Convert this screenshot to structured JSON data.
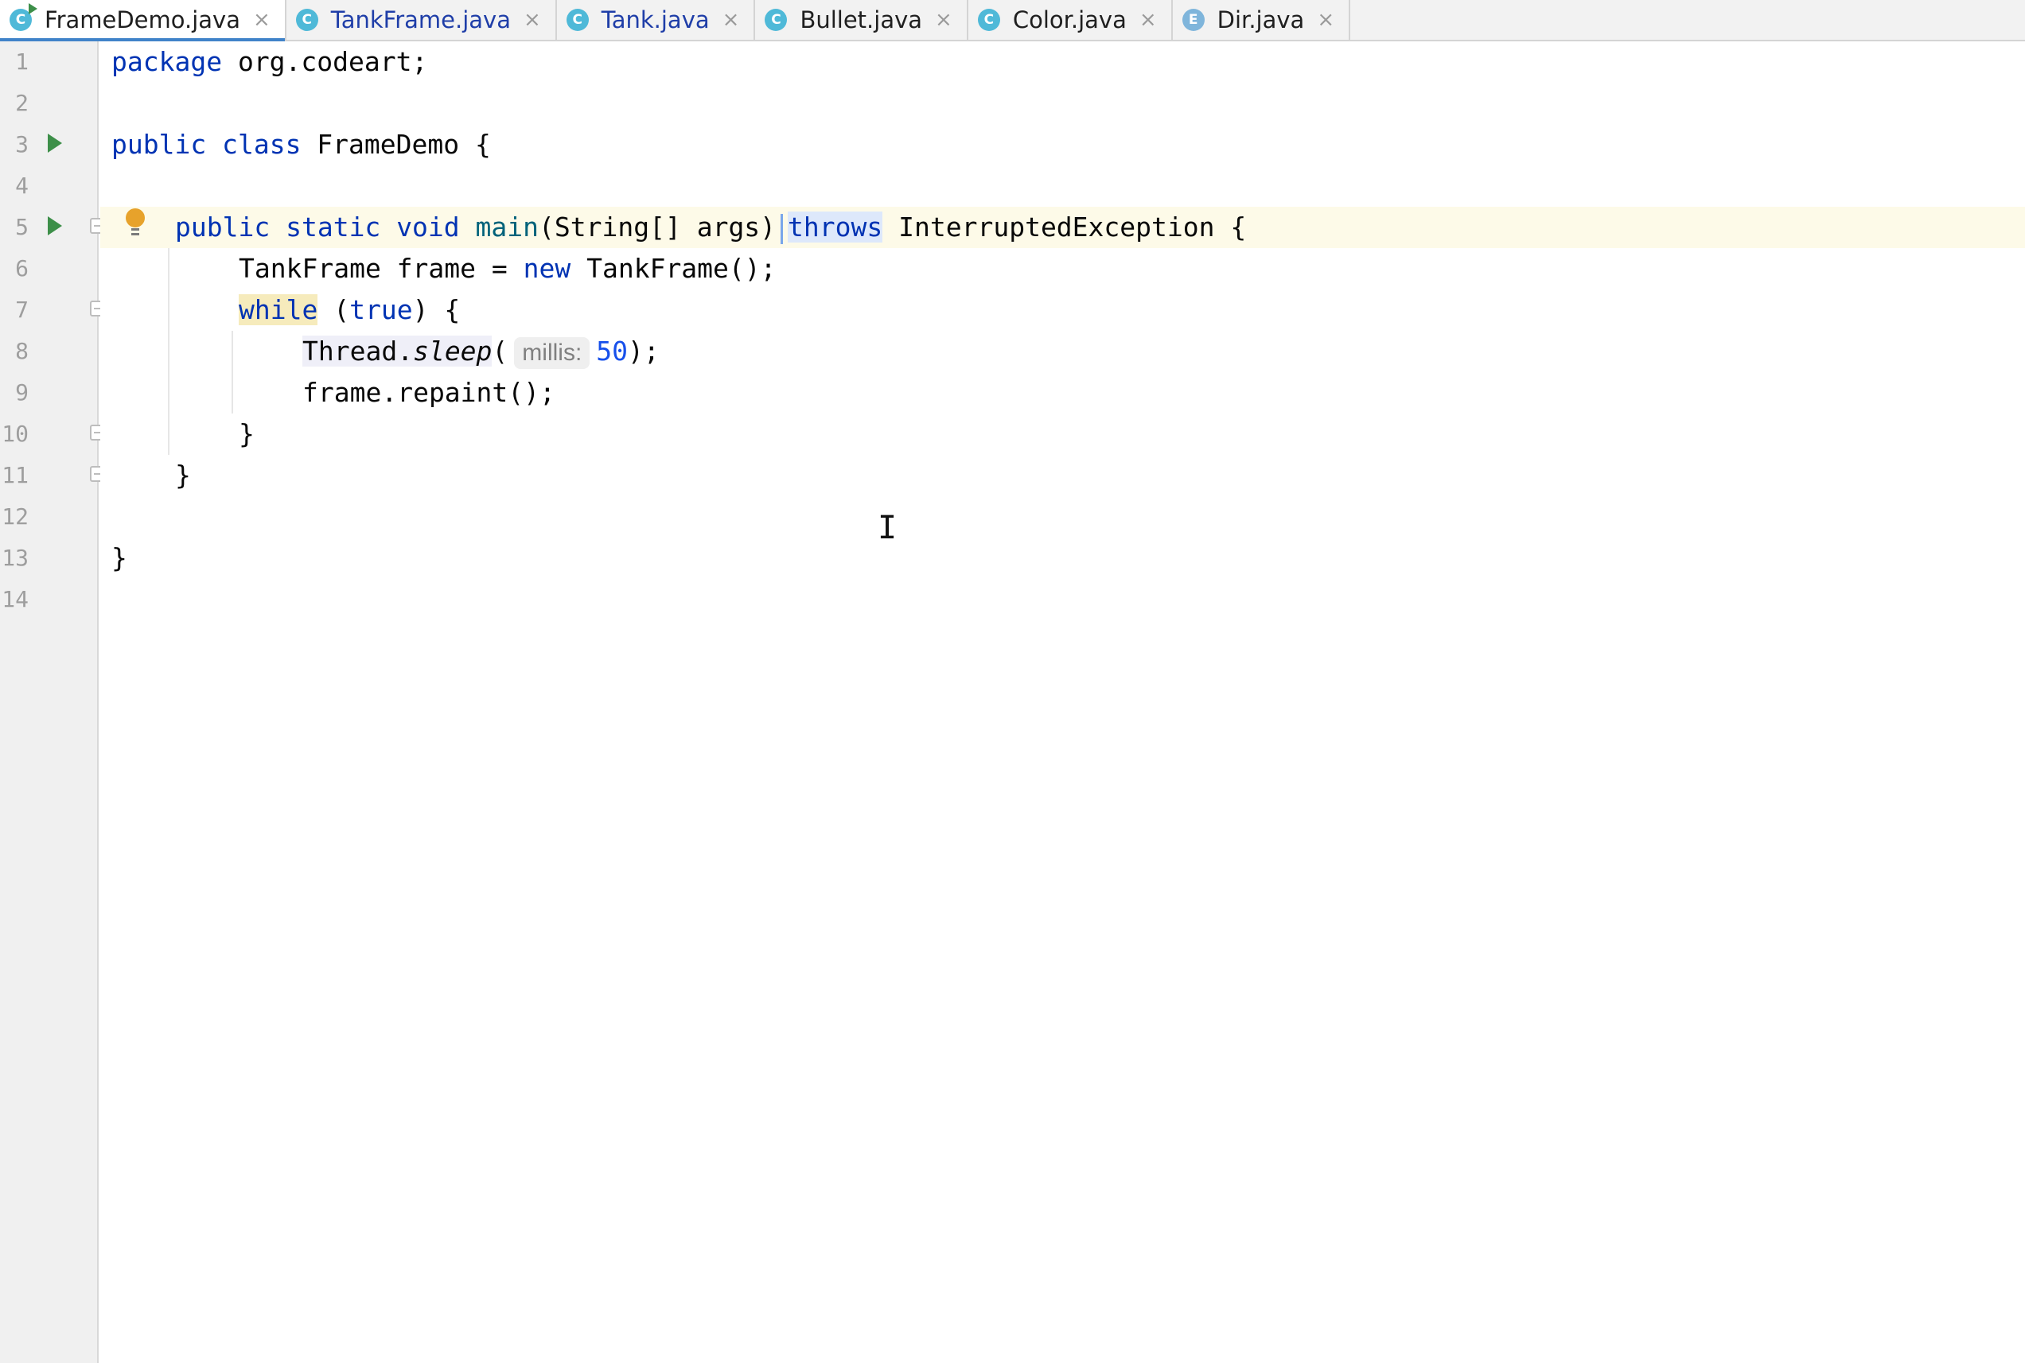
{
  "tabs": [
    {
      "label": "FrameDemo.java",
      "icon": "C",
      "active": true
    },
    {
      "label": "TankFrame.java",
      "icon": "C",
      "active": false
    },
    {
      "label": "Tank.java",
      "icon": "C",
      "active": false
    },
    {
      "label": "Bullet.java",
      "icon": "C",
      "active": false
    },
    {
      "label": "Color.java",
      "icon": "C",
      "active": false
    },
    {
      "label": "Dir.java",
      "icon": "E",
      "active": false
    }
  ],
  "tab_close_glyph": "×",
  "line_numbers": [
    "1",
    "2",
    "3",
    "4",
    "5",
    "6",
    "7",
    "8",
    "9",
    "10",
    "11",
    "12",
    "13",
    "14"
  ],
  "code": {
    "l1": {
      "kw_package": "package",
      "rest": " org.codeart;"
    },
    "l3": {
      "kw_public": "public",
      "kw_class": "class",
      "rest": " FrameDemo {"
    },
    "l5": {
      "kw_public": "public",
      "kw_static": "static",
      "kw_void": "void",
      "fn_main": "main",
      "params": "(String[] args)",
      "kw_throws": "throws",
      "rest": " InterruptedException {"
    },
    "l6": {
      "pre": "TankFrame frame = ",
      "kw_new": "new",
      "rest": " TankFrame();"
    },
    "l7": {
      "kw_while": "while",
      "mid": " (",
      "kw_true": "true",
      "rest": ") {"
    },
    "l8": {
      "cls": "Thread.",
      "method": "sleep",
      "open": "(",
      "hint": "millis:",
      "num": "50",
      "rest": ");"
    },
    "l9": {
      "text": "frame.repaint();"
    },
    "l10": {
      "text": "}"
    },
    "l11": {
      "text": "}"
    },
    "l13": {
      "text": "}"
    }
  },
  "colors": {
    "keyword": "#0033b3",
    "method": "#00627a",
    "number": "#1750eb",
    "run_icon": "#3d8f49",
    "bulb": "#e7a22b",
    "current_line": "#fdfae8"
  },
  "icons": {
    "run": "run-gutter-icon",
    "fold": "fold-icon",
    "bulb": "intention-bulb-icon",
    "class": "class-icon",
    "enum": "enum-icon",
    "close": "close-icon",
    "cursor": "text-cursor-icon"
  }
}
